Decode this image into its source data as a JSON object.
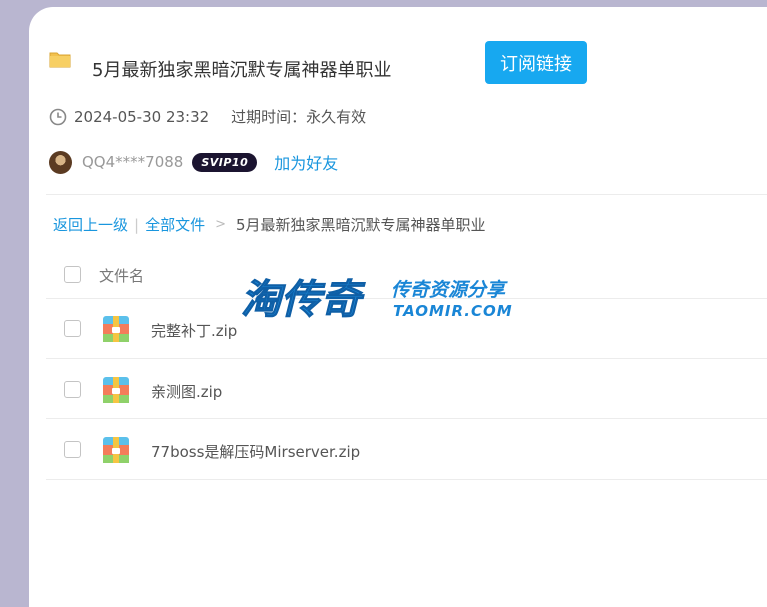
{
  "header": {
    "title": "5月最新独家黑暗沉默专属神器单职业",
    "subscribe_label": "订阅链接",
    "timestamp": "2024-05-30 23:32",
    "expire_text": "过期时间：永久有效"
  },
  "user": {
    "name": "QQ4****7088",
    "badge": "SVIP10",
    "add_friend_label": "加为好友"
  },
  "breadcrumb": {
    "back": "返回上一级",
    "separator": "|",
    "all_files": "全部文件",
    "arrow": ">",
    "current": "5月最新独家黑暗沉默专属神器单职业"
  },
  "table": {
    "column_header": "文件名",
    "files": [
      {
        "name": "完整补丁.zip"
      },
      {
        "name": "亲测图.zip"
      },
      {
        "name": "77boss是解压码Mirserver.zip"
      }
    ]
  },
  "watermark": {
    "brand": "淘传奇",
    "tagline": "传奇资源分享",
    "domain": "TAOMIR.COM"
  },
  "colors": {
    "accent": "#17a8f0",
    "link": "#1996de",
    "background": "#b9b6d0"
  },
  "icons": [
    "folder-icon",
    "clock-icon",
    "zip-icon",
    "checkbox"
  ]
}
